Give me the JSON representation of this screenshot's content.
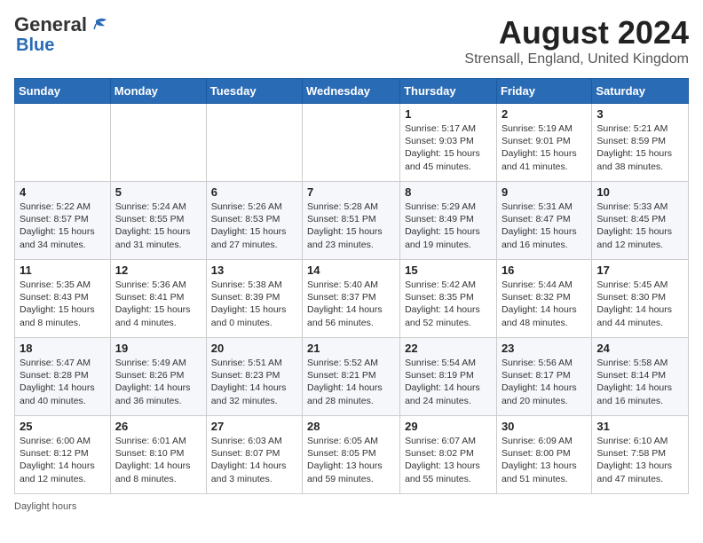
{
  "header": {
    "logo_general": "General",
    "logo_blue": "Blue",
    "main_title": "August 2024",
    "subtitle": "Strensall, England, United Kingdom"
  },
  "weekdays": [
    "Sunday",
    "Monday",
    "Tuesday",
    "Wednesday",
    "Thursday",
    "Friday",
    "Saturday"
  ],
  "weeks": [
    [
      {
        "day": "",
        "info": ""
      },
      {
        "day": "",
        "info": ""
      },
      {
        "day": "",
        "info": ""
      },
      {
        "day": "",
        "info": ""
      },
      {
        "day": "1",
        "info": "Sunrise: 5:17 AM\nSunset: 9:03 PM\nDaylight: 15 hours\nand 45 minutes."
      },
      {
        "day": "2",
        "info": "Sunrise: 5:19 AM\nSunset: 9:01 PM\nDaylight: 15 hours\nand 41 minutes."
      },
      {
        "day": "3",
        "info": "Sunrise: 5:21 AM\nSunset: 8:59 PM\nDaylight: 15 hours\nand 38 minutes."
      }
    ],
    [
      {
        "day": "4",
        "info": "Sunrise: 5:22 AM\nSunset: 8:57 PM\nDaylight: 15 hours\nand 34 minutes."
      },
      {
        "day": "5",
        "info": "Sunrise: 5:24 AM\nSunset: 8:55 PM\nDaylight: 15 hours\nand 31 minutes."
      },
      {
        "day": "6",
        "info": "Sunrise: 5:26 AM\nSunset: 8:53 PM\nDaylight: 15 hours\nand 27 minutes."
      },
      {
        "day": "7",
        "info": "Sunrise: 5:28 AM\nSunset: 8:51 PM\nDaylight: 15 hours\nand 23 minutes."
      },
      {
        "day": "8",
        "info": "Sunrise: 5:29 AM\nSunset: 8:49 PM\nDaylight: 15 hours\nand 19 minutes."
      },
      {
        "day": "9",
        "info": "Sunrise: 5:31 AM\nSunset: 8:47 PM\nDaylight: 15 hours\nand 16 minutes."
      },
      {
        "day": "10",
        "info": "Sunrise: 5:33 AM\nSunset: 8:45 PM\nDaylight: 15 hours\nand 12 minutes."
      }
    ],
    [
      {
        "day": "11",
        "info": "Sunrise: 5:35 AM\nSunset: 8:43 PM\nDaylight: 15 hours\nand 8 minutes."
      },
      {
        "day": "12",
        "info": "Sunrise: 5:36 AM\nSunset: 8:41 PM\nDaylight: 15 hours\nand 4 minutes."
      },
      {
        "day": "13",
        "info": "Sunrise: 5:38 AM\nSunset: 8:39 PM\nDaylight: 15 hours\nand 0 minutes."
      },
      {
        "day": "14",
        "info": "Sunrise: 5:40 AM\nSunset: 8:37 PM\nDaylight: 14 hours\nand 56 minutes."
      },
      {
        "day": "15",
        "info": "Sunrise: 5:42 AM\nSunset: 8:35 PM\nDaylight: 14 hours\nand 52 minutes."
      },
      {
        "day": "16",
        "info": "Sunrise: 5:44 AM\nSunset: 8:32 PM\nDaylight: 14 hours\nand 48 minutes."
      },
      {
        "day": "17",
        "info": "Sunrise: 5:45 AM\nSunset: 8:30 PM\nDaylight: 14 hours\nand 44 minutes."
      }
    ],
    [
      {
        "day": "18",
        "info": "Sunrise: 5:47 AM\nSunset: 8:28 PM\nDaylight: 14 hours\nand 40 minutes."
      },
      {
        "day": "19",
        "info": "Sunrise: 5:49 AM\nSunset: 8:26 PM\nDaylight: 14 hours\nand 36 minutes."
      },
      {
        "day": "20",
        "info": "Sunrise: 5:51 AM\nSunset: 8:23 PM\nDaylight: 14 hours\nand 32 minutes."
      },
      {
        "day": "21",
        "info": "Sunrise: 5:52 AM\nSunset: 8:21 PM\nDaylight: 14 hours\nand 28 minutes."
      },
      {
        "day": "22",
        "info": "Sunrise: 5:54 AM\nSunset: 8:19 PM\nDaylight: 14 hours\nand 24 minutes."
      },
      {
        "day": "23",
        "info": "Sunrise: 5:56 AM\nSunset: 8:17 PM\nDaylight: 14 hours\nand 20 minutes."
      },
      {
        "day": "24",
        "info": "Sunrise: 5:58 AM\nSunset: 8:14 PM\nDaylight: 14 hours\nand 16 minutes."
      }
    ],
    [
      {
        "day": "25",
        "info": "Sunrise: 6:00 AM\nSunset: 8:12 PM\nDaylight: 14 hours\nand 12 minutes."
      },
      {
        "day": "26",
        "info": "Sunrise: 6:01 AM\nSunset: 8:10 PM\nDaylight: 14 hours\nand 8 minutes."
      },
      {
        "day": "27",
        "info": "Sunrise: 6:03 AM\nSunset: 8:07 PM\nDaylight: 14 hours\nand 3 minutes."
      },
      {
        "day": "28",
        "info": "Sunrise: 6:05 AM\nSunset: 8:05 PM\nDaylight: 13 hours\nand 59 minutes."
      },
      {
        "day": "29",
        "info": "Sunrise: 6:07 AM\nSunset: 8:02 PM\nDaylight: 13 hours\nand 55 minutes."
      },
      {
        "day": "30",
        "info": "Sunrise: 6:09 AM\nSunset: 8:00 PM\nDaylight: 13 hours\nand 51 minutes."
      },
      {
        "day": "31",
        "info": "Sunrise: 6:10 AM\nSunset: 7:58 PM\nDaylight: 13 hours\nand 47 minutes."
      }
    ]
  ],
  "footer": {
    "daylight_label": "Daylight hours"
  }
}
